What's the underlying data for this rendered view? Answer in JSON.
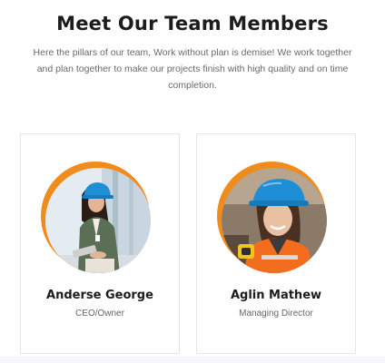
{
  "section": {
    "title": "Meet Our Team Members",
    "intro_lines": [
      "Here the pillars of our team, Work without plan is demise! We work together",
      "and plan together to make our projects finish with high quality and on time",
      "completion."
    ]
  },
  "team": [
    {
      "name": "Anderse George",
      "role": "CEO/Owner",
      "photo_icon": "woman-hardhat-tablet-photo"
    },
    {
      "name": "Aglin Mathew",
      "role": "Managing Director",
      "photo_icon": "woman-hardhat-safety-vest-photo"
    }
  ],
  "colors": {
    "accent_orange": "#f08c1c",
    "hardhat_blue": "#1e8fd6",
    "heading": "#1c1c1c",
    "body_text": "#6a6a6a"
  }
}
